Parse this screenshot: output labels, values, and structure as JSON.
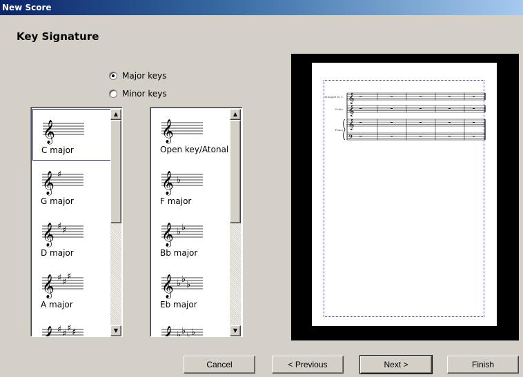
{
  "window": {
    "title": "New Score"
  },
  "page": {
    "heading": "Key Signature"
  },
  "key_type": {
    "options": [
      {
        "label": "Major keys",
        "checked": true
      },
      {
        "label": "Minor keys",
        "checked": false
      }
    ]
  },
  "major_list": {
    "selected": "C major",
    "items": [
      {
        "label": "C major",
        "accidental": "sharp",
        "count": 0
      },
      {
        "label": "G major",
        "accidental": "sharp",
        "count": 1
      },
      {
        "label": "D major",
        "accidental": "sharp",
        "count": 2
      },
      {
        "label": "A major",
        "accidental": "sharp",
        "count": 3
      },
      {
        "label": "",
        "accidental": "sharp",
        "count": 4
      }
    ]
  },
  "other_list": {
    "items": [
      {
        "label": "Open key/Atonal",
        "accidental": "flat",
        "count": 0
      },
      {
        "label": "F major",
        "accidental": "flat",
        "count": 1
      },
      {
        "label": "Bb major",
        "accidental": "flat",
        "count": 2
      },
      {
        "label": "Eb major",
        "accidental": "flat",
        "count": 3
      },
      {
        "label": "",
        "accidental": "flat",
        "count": 4
      }
    ]
  },
  "preview": {
    "instruments": [
      "Trumpet in C",
      "Violin",
      "Piano"
    ]
  },
  "buttons": {
    "cancel": "Cancel",
    "previous": "< Previous",
    "next": "Next >",
    "finish": "Finish"
  },
  "icons": {
    "scroll_up": "scroll-up-arrow-icon",
    "scroll_down": "scroll-down-arrow-icon",
    "clef": "treble-clef-icon"
  },
  "colors": {
    "window_bg": "#d4d0c8",
    "title_bar_start": "#0a246a",
    "title_bar_end": "#a6caf0",
    "selection_border": "#2b3a8a",
    "page_margin": "#2a3aa5"
  }
}
